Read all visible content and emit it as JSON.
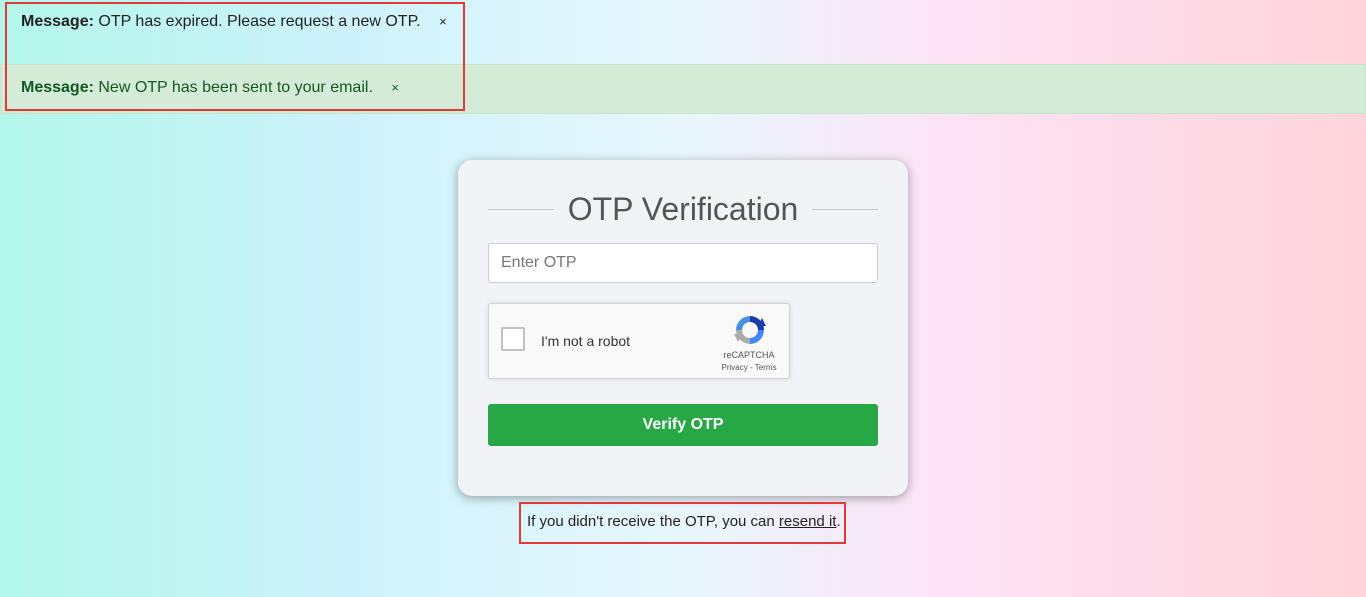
{
  "messages": {
    "expired": {
      "label": "Message:",
      "text": "OTP has expired. Please request a new OTP.",
      "close": "×"
    },
    "sent": {
      "label": "Message:",
      "text": "New OTP has been sent to your email.",
      "close": "×"
    }
  },
  "card": {
    "title": "OTP Verification",
    "otp_placeholder": "Enter OTP",
    "otp_value": "",
    "verify_label": "Verify OTP"
  },
  "recaptcha": {
    "label": "I'm not a robot",
    "brand": "reCAPTCHA",
    "privacy": "Privacy",
    "separator": " - ",
    "terms": "Terms",
    "logo_icon": "recaptcha-logo-icon"
  },
  "resend": {
    "prefix": "If you didn't receive the OTP, you can ",
    "link": "resend it",
    "suffix": "."
  },
  "colors": {
    "success_bg": "#d4ebd8",
    "success_text": "#155724",
    "button_green": "#28a745",
    "highlight_red": "#e03a3a"
  }
}
